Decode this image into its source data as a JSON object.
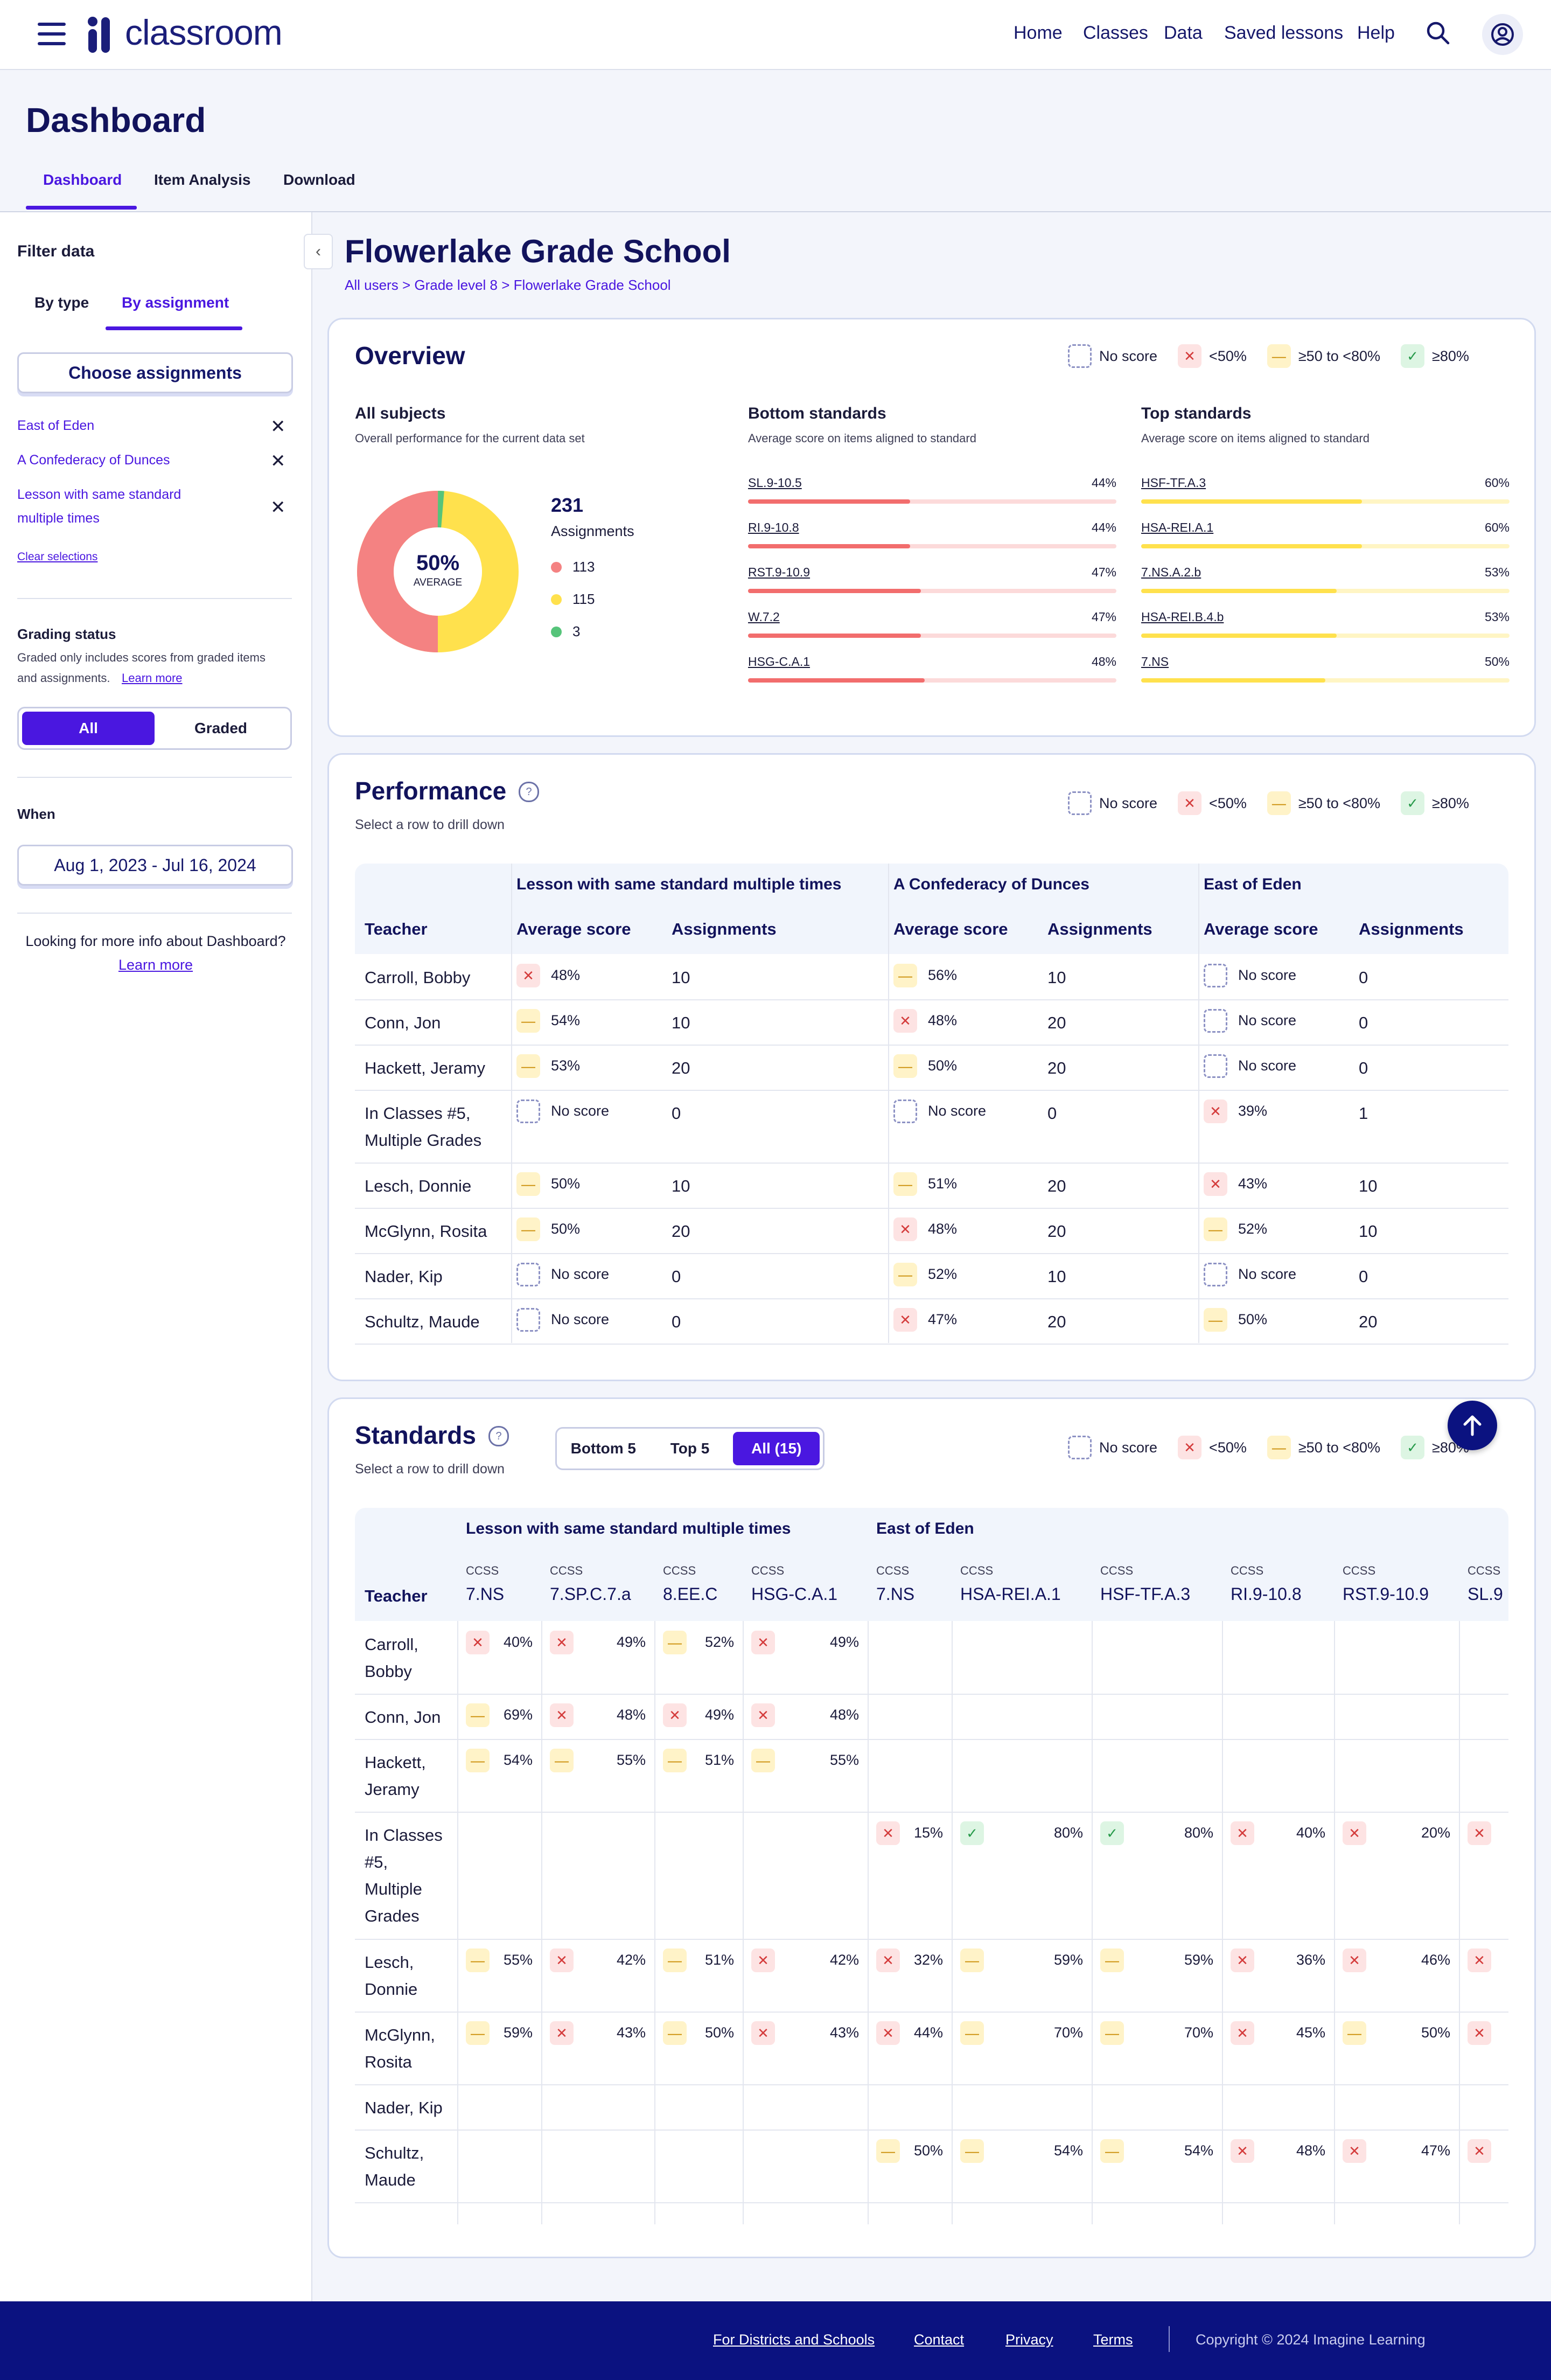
{
  "app": {
    "name": "classroom"
  },
  "nav": {
    "home": "Home",
    "classes": "Classes",
    "data": "Data",
    "saved": "Saved lessons",
    "help": "Help"
  },
  "page": {
    "title": "Dashboard",
    "tabs": [
      "Dashboard",
      "Item Analysis",
      "Download"
    ]
  },
  "sidebar": {
    "filter_title": "Filter data",
    "by_type": "By type",
    "by_assignment": "By assignment",
    "choose": "Choose assignments",
    "selected": [
      "East of Eden",
      "A Confederacy of Dunces",
      "Lesson with same standard",
      "multiple times"
    ],
    "clear": "Clear selections",
    "grading_title": "Grading status",
    "grading_desc1": "Graded only includes scores from graded items",
    "grading_desc2": "and assignments.",
    "learn_more": "Learn more",
    "toggle_all": "All",
    "toggle_graded": "Graded",
    "when_title": "When",
    "date_range": "Aug 1, 2023 - Jul 16, 2024",
    "more_info": "Looking for more info about Dashboard?",
    "more_link": "Learn more"
  },
  "school": {
    "name": "Flowerlake Grade School",
    "crumb_all": "All users",
    "crumb_grade": "Grade level 8",
    "crumb_school": "Flowerlake Grade School",
    "sep": ">"
  },
  "legend": {
    "none": "No score",
    "low": "<50%",
    "mid": "≥50 to <80%",
    "high": "≥80%"
  },
  "overview": {
    "title": "Overview",
    "all_subjects": "All subjects",
    "all_desc": "Overall performance for the current data set",
    "avg_pct": "50%",
    "avg_label": "AVERAGE",
    "total": "231",
    "total_label": "Assignments",
    "counts": {
      "red": "113",
      "yellow": "115",
      "green": "3"
    },
    "bottom_title": "Bottom standards",
    "bottom_desc": "Average score on items aligned to standard",
    "bottom": [
      {
        "label": "SL.9-10.5",
        "value": "44%",
        "pct": 44
      },
      {
        "label": "RI.9-10.8",
        "value": "44%",
        "pct": 44
      },
      {
        "label": "RST.9-10.9",
        "value": "47%",
        "pct": 47
      },
      {
        "label": "W.7.2",
        "value": "47%",
        "pct": 47
      },
      {
        "label": "HSG-C.A.1",
        "value": "48%",
        "pct": 48
      }
    ],
    "top_title": "Top standards",
    "top_desc": "Average score on items aligned to standard",
    "top": [
      {
        "label": "HSF-TF.A.3",
        "value": "60%",
        "pct": 60
      },
      {
        "label": "HSA-REI.A.1",
        "value": "60%",
        "pct": 60
      },
      {
        "label": "7.NS.A.2.b",
        "value": "53%",
        "pct": 53
      },
      {
        "label": "HSA-REI.B.4.b",
        "value": "53%",
        "pct": 53
      },
      {
        "label": "7.NS",
        "value": "50%",
        "pct": 50
      }
    ]
  },
  "performance": {
    "title": "Performance",
    "subtitle": "Select a row to drill down",
    "groups": [
      "Lesson with same standard multiple times",
      "A Confederacy of Dunces",
      "East of Eden"
    ],
    "teacher_col": "Teacher",
    "avg_col": "Average score",
    "assign_col": "Assignments",
    "rows": [
      {
        "teacher": [
          "Carroll, Bobby"
        ],
        "cells": [
          [
            "red",
            "48%",
            "10"
          ],
          [
            "yel",
            "56%",
            "10"
          ],
          [
            "none",
            "No score",
            "0"
          ]
        ]
      },
      {
        "teacher": [
          "Conn, Jon"
        ],
        "cells": [
          [
            "yel",
            "54%",
            "10"
          ],
          [
            "red",
            "48%",
            "20"
          ],
          [
            "none",
            "No score",
            "0"
          ]
        ]
      },
      {
        "teacher": [
          "Hackett, Jeramy"
        ],
        "cells": [
          [
            "yel",
            "53%",
            "20"
          ],
          [
            "yel",
            "50%",
            "20"
          ],
          [
            "none",
            "No score",
            "0"
          ]
        ]
      },
      {
        "teacher": [
          "In Classes #5,",
          "Multiple Grades"
        ],
        "cells": [
          [
            "none",
            "No score",
            "0"
          ],
          [
            "none",
            "No score",
            "0"
          ],
          [
            "red",
            "39%",
            "1"
          ]
        ]
      },
      {
        "teacher": [
          "Lesch, Donnie"
        ],
        "cells": [
          [
            "yel",
            "50%",
            "10"
          ],
          [
            "yel",
            "51%",
            "20"
          ],
          [
            "red",
            "43%",
            "10"
          ]
        ]
      },
      {
        "teacher": [
          "McGlynn, Rosita"
        ],
        "cells": [
          [
            "yel",
            "50%",
            "20"
          ],
          [
            "red",
            "48%",
            "20"
          ],
          [
            "yel",
            "52%",
            "10"
          ]
        ]
      },
      {
        "teacher": [
          "Nader, Kip"
        ],
        "cells": [
          [
            "none",
            "No score",
            "0"
          ],
          [
            "yel",
            "52%",
            "10"
          ],
          [
            "none",
            "No score",
            "0"
          ]
        ]
      },
      {
        "teacher": [
          "Schultz, Maude"
        ],
        "cells": [
          [
            "none",
            "No score",
            "0"
          ],
          [
            "red",
            "47%",
            "20"
          ],
          [
            "yel",
            "50%",
            "20"
          ]
        ]
      }
    ]
  },
  "standards": {
    "title": "Standards",
    "subtitle": "Select a row to drill down",
    "seg": [
      "Bottom 5",
      "Top 5",
      "All (15)"
    ],
    "groups": [
      "Lesson with same standard multiple times",
      "East of Eden"
    ],
    "teacher_col": "Teacher",
    "cols": [
      {
        "pre": "CCSS",
        "code": "7.NS"
      },
      {
        "pre": "CCSS",
        "code": "7.SP.C.7.a"
      },
      {
        "pre": "CCSS",
        "code": "8.EE.C"
      },
      {
        "pre": "CCSS",
        "code": "HSG-C.A.1"
      },
      {
        "pre": "CCSS",
        "code": "7.NS"
      },
      {
        "pre": "CCSS",
        "code": "HSA-REI.A.1"
      },
      {
        "pre": "CCSS",
        "code": "HSF-TF.A.3"
      },
      {
        "pre": "CCSS",
        "code": "RI.9-10.8"
      },
      {
        "pre": "CCSS",
        "code": "RST.9-10.9"
      },
      {
        "pre": "CCSS",
        "code": "SL.9"
      }
    ],
    "rows": [
      {
        "teacher": [
          "Carroll,",
          "Bobby"
        ],
        "cells": [
          [
            "red",
            "40%"
          ],
          [
            "red",
            "49%"
          ],
          [
            "yel",
            "52%"
          ],
          [
            "red",
            "49%"
          ],
          null,
          null,
          null,
          null,
          null,
          null
        ]
      },
      {
        "teacher": [
          "Conn, Jon"
        ],
        "cells": [
          [
            "yel",
            "69%"
          ],
          [
            "red",
            "48%"
          ],
          [
            "red",
            "49%"
          ],
          [
            "red",
            "48%"
          ],
          null,
          null,
          null,
          null,
          null,
          null
        ]
      },
      {
        "teacher": [
          "Hackett,",
          "Jeramy"
        ],
        "cells": [
          [
            "yel",
            "54%"
          ],
          [
            "yel",
            "55%"
          ],
          [
            "yel",
            "51%"
          ],
          [
            "yel",
            "55%"
          ],
          null,
          null,
          null,
          null,
          null,
          null
        ]
      },
      {
        "teacher": [
          "In Classes",
          "#5,",
          "Multiple",
          "Grades"
        ],
        "cells": [
          null,
          null,
          null,
          null,
          [
            "red",
            "15%"
          ],
          [
            "grn",
            "80%"
          ],
          [
            "grn",
            "80%"
          ],
          [
            "red",
            "40%"
          ],
          [
            "red",
            "20%"
          ],
          [
            "red",
            ""
          ]
        ]
      },
      {
        "teacher": [
          "Lesch,",
          "Donnie"
        ],
        "cells": [
          [
            "yel",
            "55%"
          ],
          [
            "red",
            "42%"
          ],
          [
            "yel",
            "51%"
          ],
          [
            "red",
            "42%"
          ],
          [
            "red",
            "32%"
          ],
          [
            "yel",
            "59%"
          ],
          [
            "yel",
            "59%"
          ],
          [
            "red",
            "36%"
          ],
          [
            "red",
            "46%"
          ],
          [
            "red",
            ""
          ]
        ]
      },
      {
        "teacher": [
          "McGlynn,",
          "Rosita"
        ],
        "cells": [
          [
            "yel",
            "59%"
          ],
          [
            "red",
            "43%"
          ],
          [
            "yel",
            "50%"
          ],
          [
            "red",
            "43%"
          ],
          [
            "red",
            "44%"
          ],
          [
            "yel",
            "70%"
          ],
          [
            "yel",
            "70%"
          ],
          [
            "red",
            "45%"
          ],
          [
            "yel",
            "50%"
          ],
          [
            "red",
            ""
          ]
        ]
      },
      {
        "teacher": [
          "Nader, Kip"
        ],
        "cells": [
          null,
          null,
          null,
          null,
          null,
          null,
          null,
          null,
          null,
          null
        ]
      },
      {
        "teacher": [
          "Schultz,",
          "Maude"
        ],
        "cells": [
          null,
          null,
          null,
          null,
          [
            "yel",
            "50%"
          ],
          [
            "yel",
            "54%"
          ],
          [
            "yel",
            "54%"
          ],
          [
            "red",
            "48%"
          ],
          [
            "red",
            "47%"
          ],
          [
            "red",
            ""
          ]
        ]
      }
    ]
  },
  "footer": {
    "districts": "For Districts and Schools",
    "contact": "Contact",
    "privacy": "Privacy",
    "terms": "Terms",
    "copyright": "Copyright © 2024 Imagine Learning"
  }
}
